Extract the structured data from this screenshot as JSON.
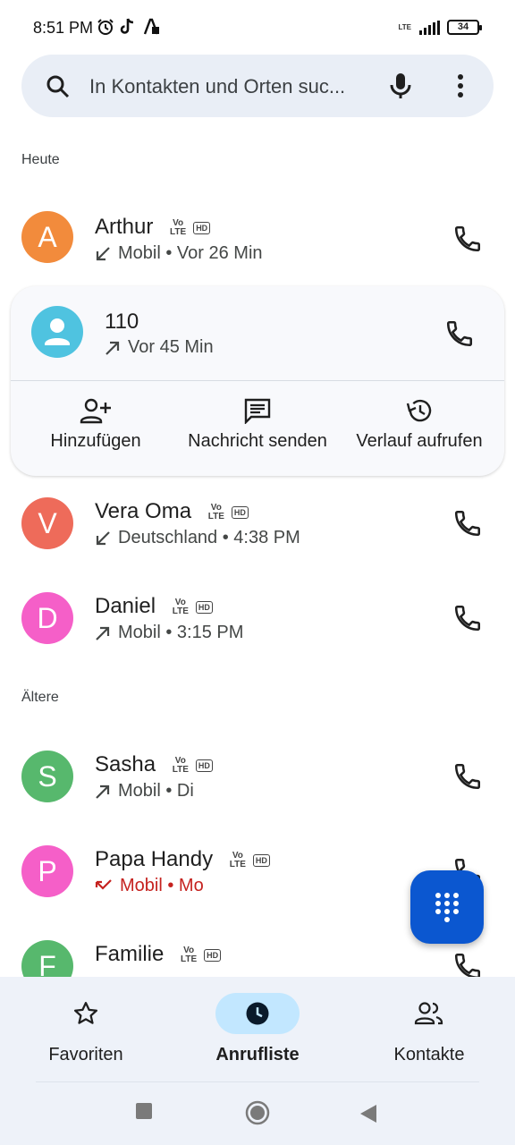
{
  "status": {
    "time": "8:51 PM",
    "battery": "34",
    "network": "LTE"
  },
  "search": {
    "placeholder": "In Kontakten und Orten suc..."
  },
  "sections": {
    "today": "Heute",
    "older": "Ältere"
  },
  "calls": [
    {
      "initial": "A",
      "name": "Arthur",
      "detail": "Mobil • Vor 26 Min",
      "direction": "incoming",
      "color": "#f28b3c"
    },
    {
      "name": "110",
      "detail": "Vor 45 Min",
      "direction": "outgoing",
      "color": "#4fc3e0"
    },
    {
      "initial": "V",
      "name": "Vera Oma",
      "detail": "Deutschland • 4:38 PM",
      "direction": "incoming",
      "color": "#ee6b5a"
    },
    {
      "initial": "D",
      "name": "Daniel",
      "detail": "Mobil • 3:15 PM",
      "direction": "outgoing",
      "color": "#f55fc8"
    },
    {
      "initial": "S",
      "name": "Sasha",
      "detail": "Mobil • Di",
      "direction": "outgoing",
      "color": "#57b86d"
    },
    {
      "initial": "P",
      "name": "Papa Handy",
      "detail": "Mobil • Mo",
      "direction": "missed",
      "color": "#f55fc8"
    },
    {
      "initial": "F",
      "name": "Familie",
      "detail": "",
      "direction": "incoming",
      "color": "#57b86d"
    }
  ],
  "badges": {
    "vo": "Vo",
    "lte": "LTE",
    "hd": "HD"
  },
  "expanded_actions": {
    "add": "Hinzufügen",
    "message": "Nachricht senden",
    "history": "Verlauf aufrufen"
  },
  "nav": {
    "favorites": "Favoriten",
    "recents": "Anrufliste",
    "contacts": "Kontakte"
  },
  "colors": {
    "accent": "#0b57d0",
    "missed": "#c5221f",
    "nav_active": "#c2e7ff"
  }
}
